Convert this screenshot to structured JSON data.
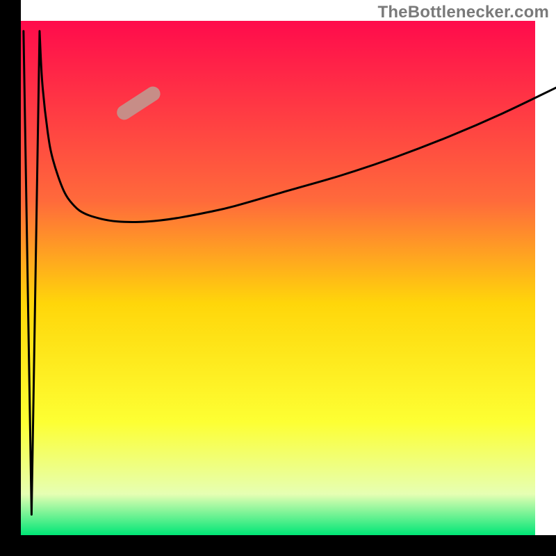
{
  "watermark": "TheBottlenecker.com",
  "colors": {
    "grad_top": "#ff0b4c",
    "grad_mid1": "#ff6a3b",
    "grad_mid2": "#ffd60a",
    "grad_mid3": "#fdff33",
    "grad_bottom_pale": "#e6ffb3",
    "grad_bottom": "#00e676",
    "curve": "#000000",
    "frame": "#000000",
    "marker_fill": "#c78d87",
    "marker_stroke": "#c78d87"
  },
  "chart_data": {
    "type": "line",
    "title": "",
    "xlabel": "",
    "ylabel": "",
    "xlim": [
      0,
      100
    ],
    "ylim": [
      0,
      100
    ],
    "grid": false,
    "legend": false,
    "background_gradient": [
      {
        "stop": 0.0,
        "color": "#ff0b4c"
      },
      {
        "stop": 0.35,
        "color": "#ff6a3b"
      },
      {
        "stop": 0.55,
        "color": "#ffd60a"
      },
      {
        "stop": 0.78,
        "color": "#fdff33"
      },
      {
        "stop": 0.92,
        "color": "#e6ffb3"
      },
      {
        "stop": 1.0,
        "color": "#00e676"
      }
    ],
    "series": [
      {
        "name": "spike",
        "x": [
          0.5,
          2.0,
          3.5
        ],
        "y": [
          98,
          4,
          98
        ]
      },
      {
        "name": "cusp-curve",
        "x": [
          3.5,
          4,
          5,
          6,
          8,
          10,
          12,
          15,
          18,
          22,
          26,
          30,
          35,
          40,
          50,
          60,
          70,
          80,
          90,
          100
        ],
        "y": [
          98,
          88,
          78.5,
          73,
          67,
          64,
          62.5,
          61.5,
          61,
          60.9,
          61.2,
          61.8,
          62.8,
          64,
          67,
          70,
          73.5,
          77.5,
          82,
          87
        ]
      }
    ],
    "marker": {
      "x": 22,
      "y": 84,
      "angle_deg": 33,
      "length": 9,
      "width": 2.7
    }
  }
}
